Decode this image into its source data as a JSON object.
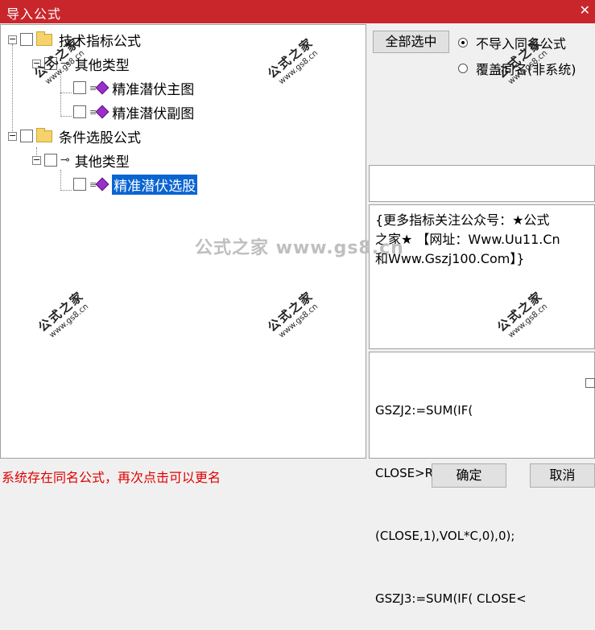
{
  "window": {
    "title": "导入公式",
    "close_glyph": "✕"
  },
  "tree": {
    "expander_minus": "−",
    "items": [
      {
        "label": "技术指标公式"
      },
      {
        "label": "其他类型"
      },
      {
        "label": "精准潜伏主图"
      },
      {
        "label": "精准潜伏副图"
      },
      {
        "label": "条件选股公式"
      },
      {
        "label": "其他类型"
      },
      {
        "label": "精准潜伏选股",
        "selected": true
      }
    ]
  },
  "buttons": {
    "select_all": "全部选中",
    "ok": "确定",
    "cancel": "取消"
  },
  "options": {
    "no_import_same_name": {
      "label": "不导入同名公式",
      "checked": true
    },
    "overwrite_same_name": {
      "label": "覆盖同名(非系统)",
      "checked": false
    }
  },
  "description": {
    "line1": "{更多指标关注公众号：★公式",
    "line2": "之家★ 【网址：Www.Uu11.Cn",
    "line3": "和Www.Gszj100.Com】}"
  },
  "formula_lines": [
    "GSZJ2:=SUM(IF(",
    "CLOSE>REF",
    "(CLOSE,1),VOL*C,0),0);",
    "GSZJ3:=SUM(IF( CLOSE<"
  ],
  "status_text": "系统存在同名公式，再次点击可以更名",
  "watermark": {
    "main": "公式之家 www.gs8.cn",
    "small_title": "公式之家",
    "small_url": "www.gs8.cn"
  },
  "colors": {
    "title_bar": "#c9262c",
    "selection": "#0a64d2",
    "status_text": "#e00000"
  }
}
